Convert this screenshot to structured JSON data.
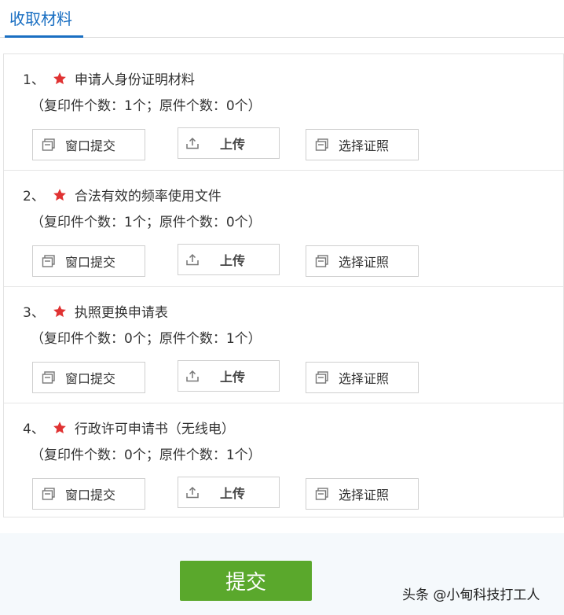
{
  "tab": {
    "label": "收取材料"
  },
  "items": [
    {
      "number": "1、",
      "title": "申请人身份证明材料",
      "counts": "（复印件个数：1个；原件个数：0个）"
    },
    {
      "number": "2、",
      "title": "合法有效的频率使用文件",
      "counts": "（复印件个数：1个；原件个数：0个）"
    },
    {
      "number": "3、",
      "title": "执照更换申请表",
      "counts": "（复印件个数：0个；原件个数：1个）"
    },
    {
      "number": "4、",
      "title": "行政许可申请书（无线电）",
      "counts": "（复印件个数：0个；原件个数：1个）"
    }
  ],
  "buttons": {
    "window_submit": "窗口提交",
    "upload": "上传",
    "choose_license": "选择证照"
  },
  "submit_label": "提交",
  "watermark": "头条 @小甸科技打工人",
  "colors": {
    "accent": "#1a6fc2",
    "star": "#e03232",
    "submit": "#5aa82c"
  },
  "icons": {
    "required": "star-icon",
    "window_submit": "window-icon",
    "upload": "upload-icon",
    "choose_license": "license-icon"
  }
}
